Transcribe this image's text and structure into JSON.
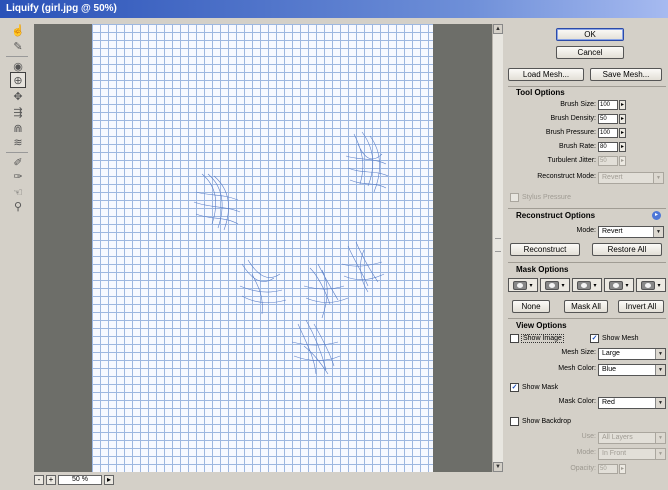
{
  "window": {
    "title": "Liquify (girl.jpg @ 50%)"
  },
  "toolbox": {
    "tools": [
      {
        "name": "forward-warp-tool-icon",
        "glyph": "☝"
      },
      {
        "name": "reconstruct-tool-icon",
        "glyph": "✎"
      },
      {
        "name": "twirl-clockwise-tool-icon",
        "glyph": "◉"
      },
      {
        "name": "pucker-tool-icon",
        "glyph": "⊕"
      },
      {
        "name": "bloat-tool-icon",
        "glyph": "✥"
      },
      {
        "name": "push-left-tool-icon",
        "glyph": "⇶"
      },
      {
        "name": "mirror-tool-icon",
        "glyph": "⋒"
      },
      {
        "name": "turbulence-tool-icon",
        "glyph": "≋"
      },
      {
        "name": "freeze-mask-tool-icon",
        "glyph": "✐"
      },
      {
        "name": "thaw-mask-tool-icon",
        "glyph": "✑"
      },
      {
        "name": "hand-tool-icon",
        "glyph": "☜"
      },
      {
        "name": "zoom-tool-icon",
        "glyph": "⚲"
      }
    ]
  },
  "zoom": {
    "minus": "-",
    "plus": "+",
    "value": "50 %",
    "menu": "▸"
  },
  "buttons": {
    "ok": "OK",
    "cancel": "Cancel",
    "load_mesh": "Load Mesh...",
    "save_mesh": "Save Mesh..."
  },
  "tool_options": {
    "title": "Tool Options",
    "brush_size": {
      "label": "Brush Size:",
      "value": "100"
    },
    "brush_density": {
      "label": "Brush Density:",
      "value": "50"
    },
    "brush_pressure": {
      "label": "Brush Pressure:",
      "value": "100"
    },
    "brush_rate": {
      "label": "Brush Rate:",
      "value": "80"
    },
    "turbulent_jitter": {
      "label": "Turbulent Jitter:",
      "value": "50"
    },
    "reconstruct_mode": {
      "label": "Reconstruct Mode:",
      "value": "Revert"
    },
    "stylus_pressure": "Stylus Pressure"
  },
  "reconstruct_options": {
    "title": "Reconstruct Options",
    "mode_label": "Mode:",
    "mode_value": "Revert",
    "reconstruct_btn": "Reconstruct",
    "restore_all_btn": "Restore All"
  },
  "mask_options": {
    "title": "Mask Options",
    "none": "None",
    "mask_all": "Mask All",
    "invert_all": "Invert All"
  },
  "view_options": {
    "title": "View Options",
    "show_image": "Show Image",
    "show_image_checked": false,
    "show_mesh": "Show Mesh",
    "show_mesh_checked": true,
    "mesh_size_label": "Mesh Size:",
    "mesh_size": "Large",
    "mesh_color_label": "Mesh Color:",
    "mesh_color": "Blue",
    "show_mask": "Show Mask",
    "show_mask_checked": true,
    "mask_color_label": "Mask Color:",
    "mask_color": "Red",
    "show_backdrop": "Show Backdrop",
    "show_backdrop_checked": false,
    "use_label": "Use:",
    "use_value": "All Layers",
    "mode_label": "Mode:",
    "mode_value": "In Front",
    "opacity_label": "Opacity:",
    "opacity_value": "50"
  },
  "colors": {
    "mesh": "#9db7e0",
    "canvas_bg": "#6d6e69",
    "panel": "#d4d0c8",
    "title_start": "#2a52b8"
  }
}
